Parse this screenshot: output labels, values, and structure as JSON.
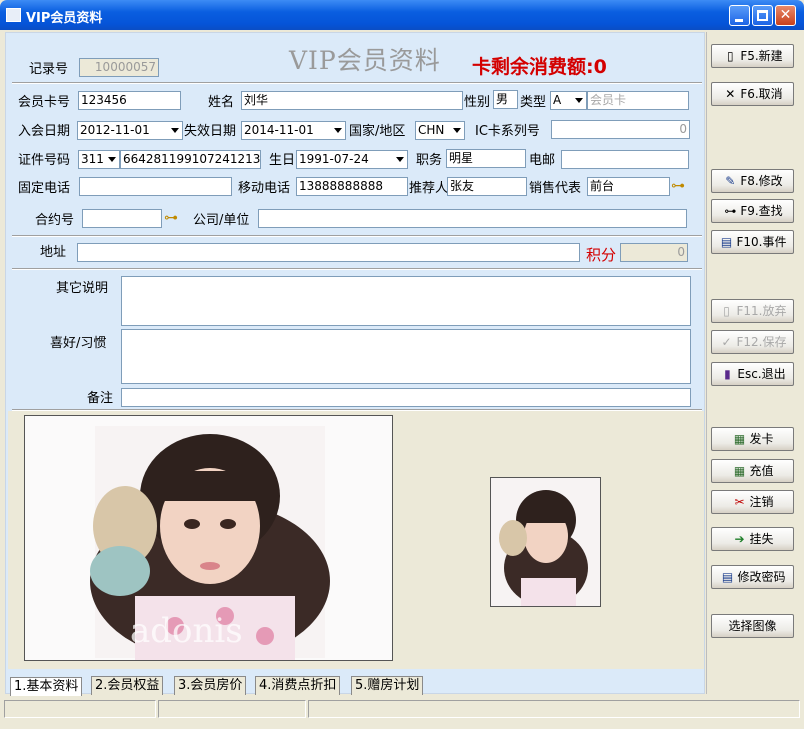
{
  "window": {
    "title": "VIP会员资料"
  },
  "header": {
    "record_label": "记录号",
    "record_value": "10000057",
    "banner_title": "VIP会员资料",
    "balance_text": "卡剩余消费额:0"
  },
  "form": {
    "card_no_label": "会员卡号",
    "card_no": "123456",
    "name_label": "姓名",
    "name": "刘华",
    "gender_label": "性别",
    "gender": "男",
    "type_label": "类型",
    "type": "A",
    "type_name_placeholder": "会员卡",
    "join_date_label": "入会日期",
    "join_date": "2012-11-01",
    "expire_date_label": "失效日期",
    "expire_date": "2014-11-01",
    "country_label": "国家/地区",
    "country": "CHN",
    "ic_label": "IC卡系列号",
    "ic_value": "0",
    "id_label": "证件号码",
    "id_type": "311",
    "id_number": "664281199107241213",
    "birthday_label": "生日",
    "birthday": "1991-07-24",
    "job_label": "职务",
    "job": "明星",
    "email_label": "电邮",
    "email": "",
    "phone_label": "固定电话",
    "phone": "",
    "mobile_label": "移动电话",
    "mobile": "13888888888",
    "referrer_label": "推荐人",
    "referrer": "张友",
    "sales_label": "销售代表",
    "sales": "前台",
    "contract_label": "合约号",
    "contract": "",
    "company_label": "公司/单位",
    "company": "",
    "address_label": "地址",
    "address": "",
    "points_label": "积分",
    "points": "0",
    "other_label": "其它说明",
    "other": "",
    "hobby_label": "喜好/习惯",
    "hobby": "",
    "remark_label": "备注",
    "remark": ""
  },
  "photo": {
    "watermark": "adonis"
  },
  "sidebar": {
    "new": "F5.新建",
    "cancel": "F6.取消",
    "edit": "F8.修改",
    "find": "F9.查找",
    "event": "F10.事件",
    "discard": "F11.放弃",
    "save": "F12.保存",
    "exit": "Esc.退出",
    "issue": "发卡",
    "recharge": "充值",
    "revoke": "注销",
    "report_loss": "挂失",
    "change_password": "修改密码",
    "choose_image": "选择图像"
  },
  "tabs": [
    "1.基本资料",
    "2.会员权益",
    "3.会员房价",
    "4.消费点折扣",
    "5.赠房计划"
  ],
  "colors": {
    "accent_red": "#d40000",
    "title_blue": "#0a5ee0",
    "banner_gray": "#9a9a9a"
  }
}
